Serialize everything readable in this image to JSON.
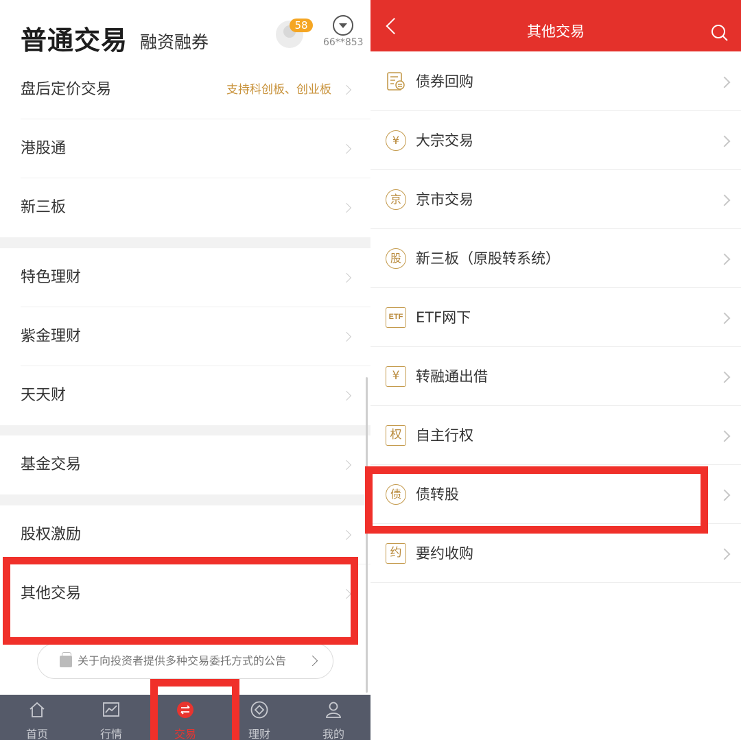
{
  "left": {
    "header": {
      "title": "普通交易",
      "subtitle": "融资融券",
      "badge_count": "58",
      "account": "66**853"
    },
    "menu": [
      {
        "label": "盘后定价交易",
        "hint": "支持科创板、创业板"
      },
      {
        "label": "港股通"
      },
      {
        "label": "新三板"
      },
      {
        "label": "特色理财"
      },
      {
        "label": "紫金理财"
      },
      {
        "label": "天天财"
      },
      {
        "label": "基金交易"
      },
      {
        "label": "股权激励"
      },
      {
        "label": "其他交易"
      }
    ],
    "notice": "关于向投资者提供多种交易委托方式的公告",
    "tabs": [
      {
        "label": "首页",
        "icon": "home-icon"
      },
      {
        "label": "行情",
        "icon": "chart-icon"
      },
      {
        "label": "交易",
        "icon": "exchange-icon",
        "active": true
      },
      {
        "label": "理财",
        "icon": "diamond-icon"
      },
      {
        "label": "我的",
        "icon": "person-icon"
      }
    ]
  },
  "right": {
    "header": {
      "title": "其他交易"
    },
    "items": [
      {
        "label": "债券回购",
        "icon_text": "",
        "icon": "bond-doc-icon"
      },
      {
        "label": "大宗交易",
        "icon_text": "¥",
        "icon": "yen-cycle-icon"
      },
      {
        "label": "京市交易",
        "icon_text": "京",
        "icon": "jing-icon"
      },
      {
        "label": "新三板（原股转系统）",
        "icon_text": "股",
        "icon": "gu-icon"
      },
      {
        "label": "ETF网下",
        "icon_text": "ETF",
        "icon": "etf-icon"
      },
      {
        "label": "转融通出借",
        "icon_text": "¥",
        "icon": "yen-box-icon"
      },
      {
        "label": "自主行权",
        "icon_text": "权",
        "icon": "quan-icon"
      },
      {
        "label": "债转股",
        "icon_text": "债",
        "icon": "zhai-icon"
      },
      {
        "label": "要约收购",
        "icon_text": "约",
        "icon": "yue-icon"
      }
    ]
  },
  "colors": {
    "accent_red": "#e4312b",
    "highlight_red": "#f0302a",
    "gold": "#c49a4c",
    "tabbar": "#555a69",
    "badge": "#f5a623"
  }
}
